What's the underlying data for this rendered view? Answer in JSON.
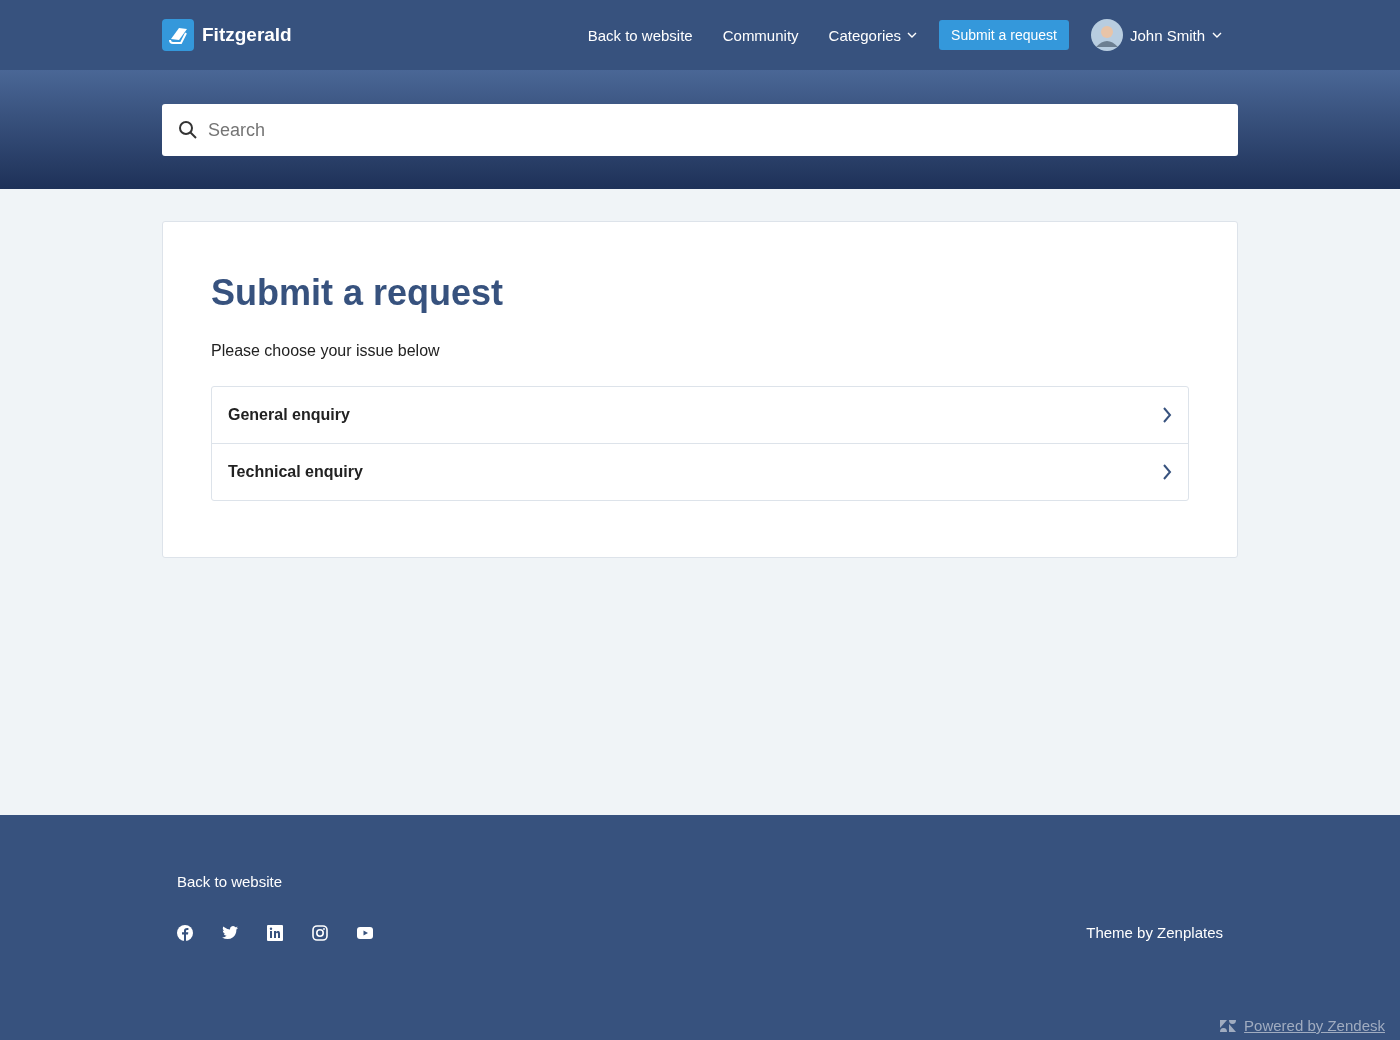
{
  "header": {
    "brand": "Fitzgerald",
    "nav": [
      {
        "label": "Back to website",
        "kind": "link"
      },
      {
        "label": "Community",
        "kind": "link"
      },
      {
        "label": "Categories",
        "kind": "dropdown"
      },
      {
        "label": "Submit a request",
        "kind": "button"
      }
    ],
    "user": {
      "name": "John Smith"
    }
  },
  "search": {
    "placeholder": "Search"
  },
  "main": {
    "title": "Submit a request",
    "subtitle": "Please choose your issue below",
    "options": [
      "General enquiry",
      "Technical enquiry"
    ]
  },
  "footer": {
    "link": "Back to website",
    "social": [
      {
        "kind": "facebook"
      },
      {
        "kind": "twitter"
      },
      {
        "kind": "linkedin"
      },
      {
        "kind": "instagram"
      },
      {
        "kind": "youtube"
      }
    ],
    "credit": "Theme by Zenplates",
    "powered": "Powered by Zendesk"
  }
}
